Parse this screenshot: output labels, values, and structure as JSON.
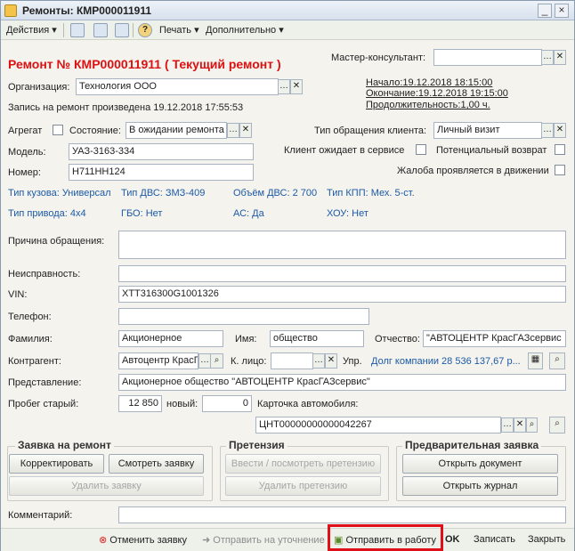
{
  "window": {
    "title": "Ремонты: КМР000011911"
  },
  "toolbar": {
    "actions": "Действия",
    "help": "?",
    "print": "Печать",
    "more": "Дополнительно"
  },
  "header": {
    "title": "Ремонт № КМР000011911 ( Текущий ремонт )",
    "master_label": "Мастер-консультант:",
    "master_value": "",
    "org_label": "Организация:",
    "org_value": "Технология ООО",
    "record_text": "Запись на ремонт произведена 19.12.2018 17:55:53",
    "start": "Начало:19.12.2018 18:15:00",
    "end": "Окончание:19.12.2018 19:15:00",
    "duration": "Продолжительность:1,00 ч."
  },
  "form": {
    "aggregate_label": "Агрегат",
    "state_label": "Состояние:",
    "state_value": "В ожидании ремонта",
    "appeal_type_label": "Тип обращения клиента:",
    "appeal_type_value": "Личный визит",
    "client_waits_label": "Клиент ожидает в сервисе",
    "potential_return_label": "Потенциальный возврат",
    "complaint_label": "Жалоба проявляется в движении",
    "model_label": "Модель:",
    "model_value": "УАЗ-3163-334",
    "number_label": "Номер:",
    "number_value": "Н711НН124",
    "body_type": "Тип кузова: Универсал",
    "engine_type": "Тип ДВС: ЗМЗ-409",
    "engine_volume": "Объём ДВС: 2 700",
    "gearbox": "Тип КПП: Мех. 5-ст.",
    "drive": "Тип привода: 4х4",
    "gbo": "ГБО: Нет",
    "ac": "АС: Да",
    "xou": "ХОУ: Нет",
    "reason_label": "Причина обращения:",
    "reason_value": "",
    "fault_label": "Неисправность:",
    "fault_value": "",
    "vin_label": "VIN:",
    "vin_value": "ХТТ316300G1001326",
    "phone_label": "Телефон:",
    "phone_value": "",
    "surname_label": "Фамилия:",
    "surname_value": "Акционерное",
    "name_label": "Имя:",
    "name_value": "общество",
    "patronymic_label": "Отчество:",
    "patronymic_value": "\"АВТОЦЕНТР КрасГАЗсервис",
    "counterparty_label": "Контрагент:",
    "counterparty_value": "Автоцентр КрасГ",
    "contact_label": "К. лицо:",
    "contact_value": "",
    "upr_label": "Упр.",
    "debt_text": "Долг компании 28 536 137,67 р...",
    "representation_label": "Представление:",
    "representation_value": "Акционерное общество \"АВТОЦЕНТР КрасГАЗсервис\"",
    "mileage_old_label": "Пробег старый:",
    "mileage_old_value": "12 850",
    "mileage_new_label": "новый:",
    "mileage_new_value": "0",
    "car_card_label": "Карточка автомобиля:",
    "car_card_value": "ЦНТ00000000000042267",
    "comment_label": "Комментарий:",
    "comment_value": ""
  },
  "groups": {
    "repair_request": {
      "title": "Заявка на ремонт",
      "correct": "Корректировать",
      "view": "Смотреть заявку",
      "delete": "Удалить заявку"
    },
    "claim": {
      "title": "Претензия",
      "enter_view": "Ввести / посмотреть претензию",
      "delete": "Удалить претензию"
    },
    "preliminary": {
      "title": "Предварительная заявка",
      "open_doc": "Открыть документ",
      "open_journal": "Открыть журнал"
    }
  },
  "footer": {
    "cancel_request": "Отменить заявку",
    "send_clarify": "Отправить на уточнение",
    "send_to_work": "Отправить в работу",
    "ok": "OK",
    "save": "Записать",
    "close": "Закрыть"
  }
}
